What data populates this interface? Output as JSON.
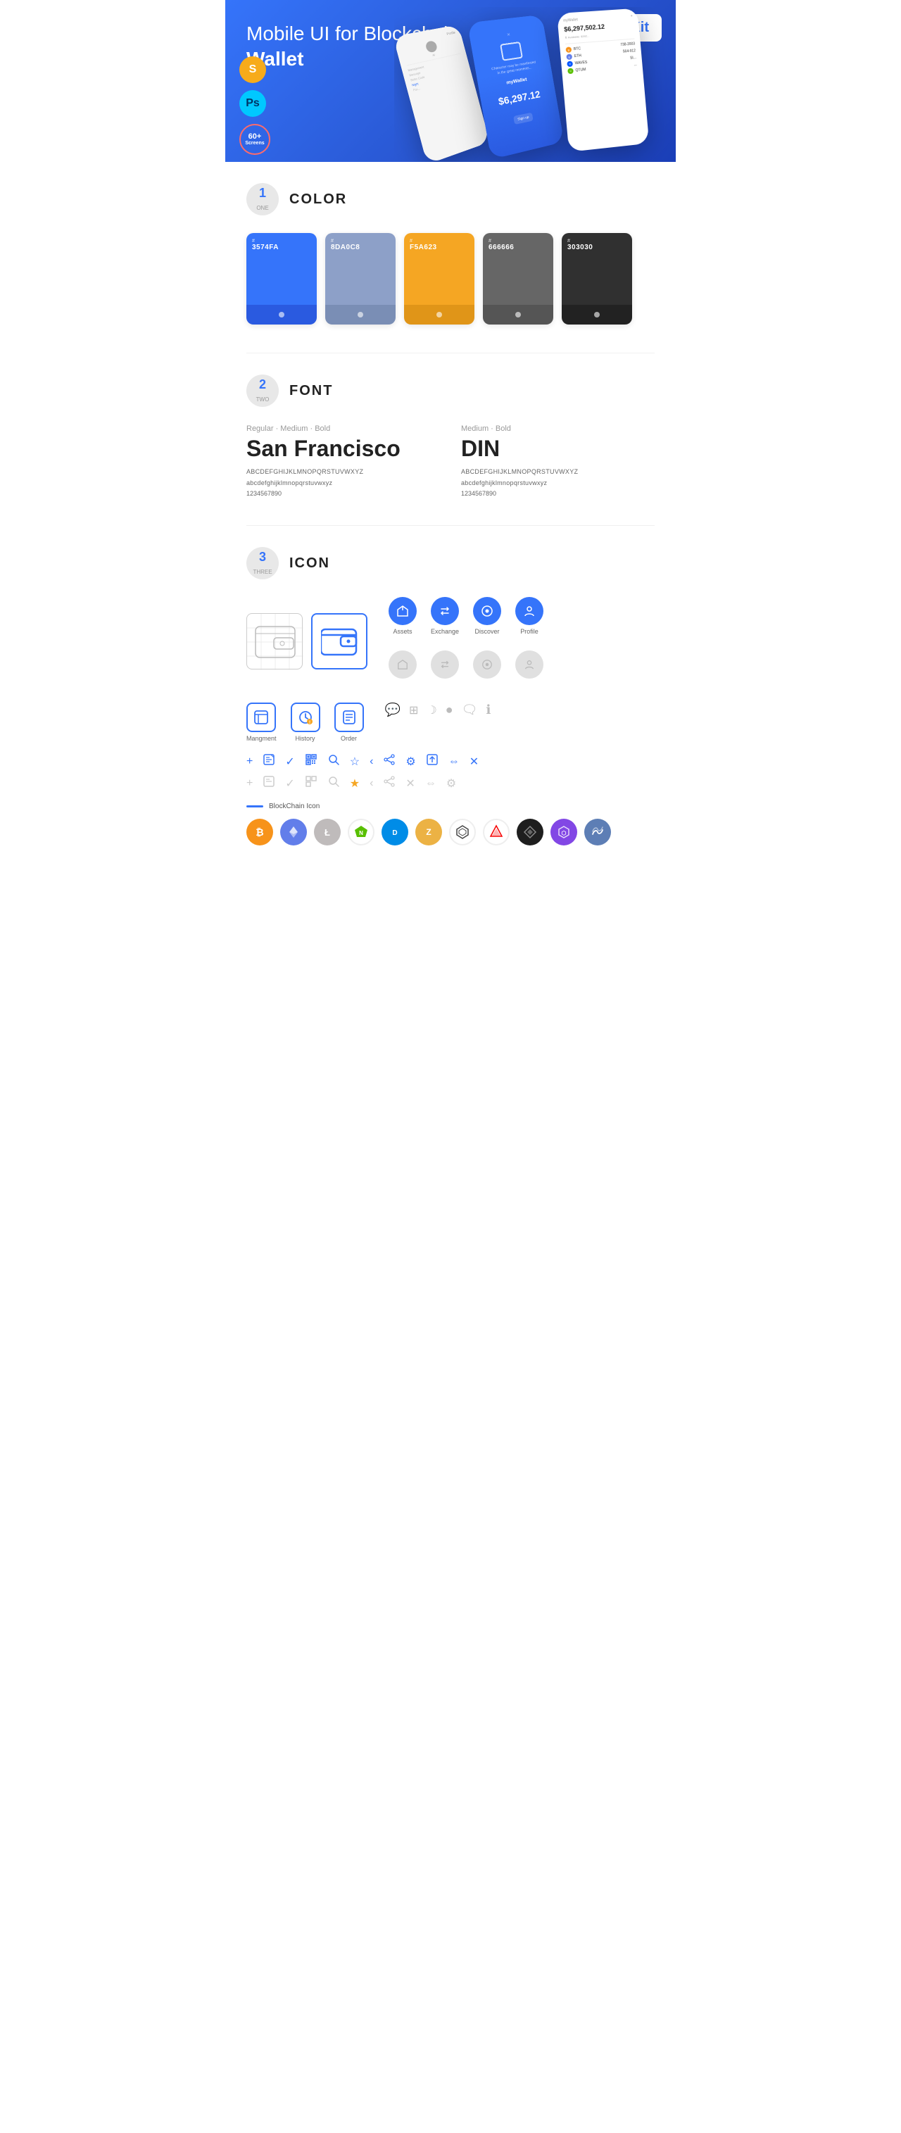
{
  "hero": {
    "title_normal": "Mobile UI for Blockchain ",
    "title_bold": "Wallet",
    "badge": "UI Kit",
    "tools": [
      {
        "name": "Sketch",
        "symbol": "S"
      },
      {
        "name": "Photoshop",
        "symbol": "Ps"
      },
      {
        "name": "Screens",
        "line1": "60+",
        "line2": "Screens"
      }
    ]
  },
  "sections": {
    "color": {
      "number": "1",
      "word": "ONE",
      "title": "COLOR",
      "swatches": [
        {
          "hex": "3574FA",
          "color": "#3574FA",
          "bottom": "#2a5ae0"
        },
        {
          "hex": "8DA0C8",
          "color": "#8DA0C8",
          "bottom": "#7a8eb5"
        },
        {
          "hex": "F5A623",
          "color": "#F5A623",
          "bottom": "#e09518"
        },
        {
          "hex": "666666",
          "color": "#666666",
          "bottom": "#555555"
        },
        {
          "hex": "303030",
          "color": "#303030",
          "bottom": "#222222"
        }
      ]
    },
    "font": {
      "number": "2",
      "word": "TWO",
      "title": "FONT",
      "fonts": [
        {
          "label": "Regular · Medium · Bold",
          "name": "San Francisco",
          "upper": "ABCDEFGHIJKLMNOPQRSTUVWXYZ",
          "lower": "abcdefghijklmnopqrstuvwxyz",
          "numbers": "1234567890"
        },
        {
          "label": "Medium · Bold",
          "name": "DIN",
          "upper": "ABCDEFGHIJKLMNOPQRSTUVWXYZ",
          "lower": "abcdefghijklmnopqrstuvwxyz",
          "numbers": "1234567890"
        }
      ]
    },
    "icon": {
      "number": "3",
      "word": "THREE",
      "title": "ICON",
      "nav_icons": [
        {
          "label": "Assets",
          "symbol": "◆"
        },
        {
          "label": "Exchange",
          "symbol": "⇄"
        },
        {
          "label": "Discover",
          "symbol": "●"
        },
        {
          "label": "Profile",
          "symbol": "○"
        }
      ],
      "app_icons": [
        {
          "label": "Mangment",
          "symbol": "▣"
        },
        {
          "label": "History",
          "symbol": "◷"
        },
        {
          "label": "Order",
          "symbol": "≡"
        }
      ],
      "blockchain_label": "BlockChain Icon",
      "crypto_coins": [
        {
          "name": "Bitcoin",
          "symbol": "₿",
          "class": "ci-btc"
        },
        {
          "name": "Ethereum",
          "symbol": "Ξ",
          "class": "ci-eth"
        },
        {
          "name": "Litecoin",
          "symbol": "Ł",
          "class": "ci-ltc"
        },
        {
          "name": "NEO",
          "symbol": "N",
          "class": "ci-neo"
        },
        {
          "name": "Dash",
          "symbol": "D",
          "class": "ci-dash"
        },
        {
          "name": "Zcash",
          "symbol": "Z",
          "class": "ci-zcash"
        },
        {
          "name": "IOTA",
          "symbol": "⬡",
          "class": "ci-iota"
        },
        {
          "name": "ARK",
          "symbol": "▲",
          "class": "ci-ark"
        },
        {
          "name": "Enigma",
          "symbol": "◈",
          "class": "ci-enigma"
        },
        {
          "name": "Polygon",
          "symbol": "⬡",
          "class": "ci-polygon"
        },
        {
          "name": "Waves",
          "symbol": "∿",
          "class": "ci-waves"
        }
      ]
    }
  }
}
